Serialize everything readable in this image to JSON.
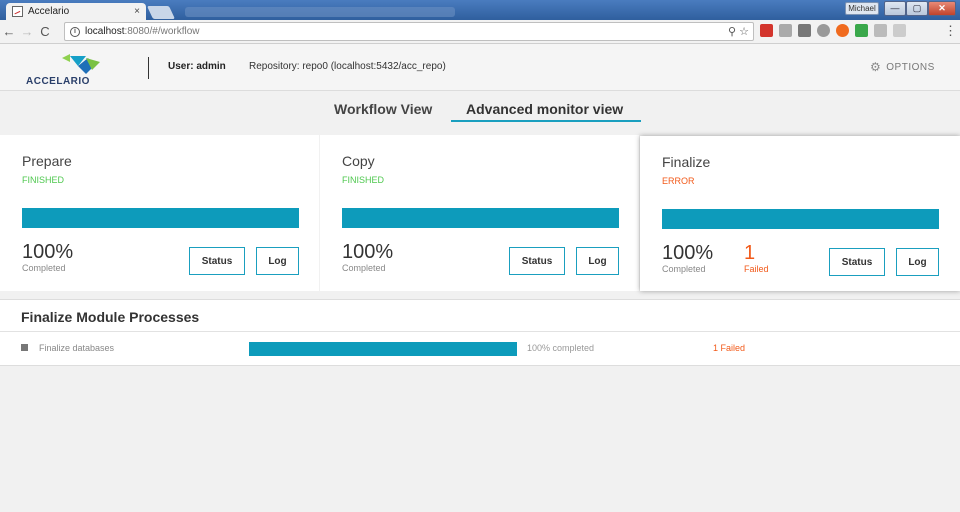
{
  "browser": {
    "tab_title": "Accelario",
    "tab_close": "×",
    "url_host": "localhost",
    "url_path": ":8080/#/workflow",
    "window_user": "Michael",
    "win_min": "—",
    "win_max": "▢",
    "win_close": "✕",
    "back": "←",
    "forward": "→",
    "reload": "C",
    "info": "i",
    "omni_right": "⚲ ☆",
    "menu": "⋮"
  },
  "header": {
    "logo_text": "ACCELARIO",
    "user_label": "User: admin",
    "repository_label": "Repository: repo0 (localhost:5432/acc_repo)",
    "options_label": "OPTIONS",
    "gear_icon": "⚙"
  },
  "tabs": [
    {
      "label": "Workflow View",
      "active": false
    },
    {
      "label": "Advanced monitor view",
      "active": true
    }
  ],
  "stages": [
    {
      "title": "Prepare",
      "status": "FINISHED",
      "percent": "100%",
      "progress": 1.0,
      "completed_label": "Completed",
      "status_button": "Status",
      "log_button": "Log"
    },
    {
      "title": "Copy",
      "status": "FINISHED",
      "percent": "100%",
      "progress": 1.0,
      "completed_label": "Completed",
      "status_button": "Status",
      "log_button": "Log"
    },
    {
      "title": "Finalize",
      "status": "ERROR",
      "percent": "100%",
      "progress": 1.0,
      "completed_label": "Completed",
      "failed_count": "1",
      "failed_label": "Failed",
      "status_button": "Status",
      "log_button": "Log"
    }
  ],
  "processes": {
    "title": "Finalize Module Processes",
    "rows": [
      {
        "name": "Finalize databases",
        "progress": 1.0,
        "percent_text": "100% completed",
        "failed_text": "1 Failed"
      }
    ]
  },
  "colors": {
    "accent": "#0d9bbb",
    "ok": "#4fc84f",
    "error": "#f25a1a"
  }
}
